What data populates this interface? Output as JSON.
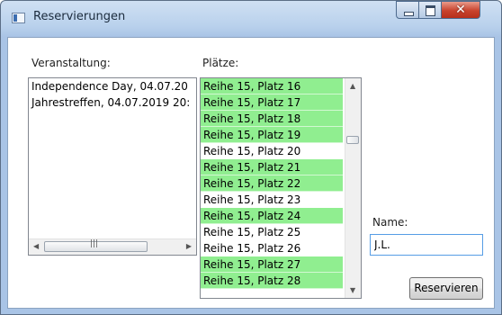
{
  "window": {
    "title": "Reservierungen"
  },
  "labels": {
    "events": "Veranstaltung:",
    "seats": "Plätze:",
    "name": "Name:"
  },
  "events": [
    "Independence Day, 04.07.20",
    "Jahrestreffen, 04.07.2019 20:"
  ],
  "seats": [
    {
      "label": "Reihe 15, Platz 16",
      "reserved": true
    },
    {
      "label": "Reihe 15, Platz 17",
      "reserved": true
    },
    {
      "label": "Reihe 15, Platz 18",
      "reserved": true
    },
    {
      "label": "Reihe 15, Platz 19",
      "reserved": true
    },
    {
      "label": "Reihe 15, Platz 20",
      "reserved": false
    },
    {
      "label": "Reihe 15, Platz 21",
      "reserved": true
    },
    {
      "label": "Reihe 15, Platz 22",
      "reserved": true
    },
    {
      "label": "Reihe 15, Platz 23",
      "reserved": false
    },
    {
      "label": "Reihe 15, Platz 24",
      "reserved": true
    },
    {
      "label": "Reihe 15, Platz 25",
      "reserved": false
    },
    {
      "label": "Reihe 15, Platz 26",
      "reserved": false
    },
    {
      "label": "Reihe 15, Platz 27",
      "reserved": true
    },
    {
      "label": "Reihe 15, Platz 28",
      "reserved": true
    }
  ],
  "name_input": {
    "value": "J.L."
  },
  "reserve_button": {
    "label": "Reservieren"
  },
  "colors": {
    "reserved": "#90ee90",
    "free": "#ffffff",
    "close": "#c8432d"
  },
  "icons": {
    "app": "window-icon",
    "minimize": "minimize-icon",
    "maximize": "maximize-icon",
    "close": "close-icon"
  }
}
